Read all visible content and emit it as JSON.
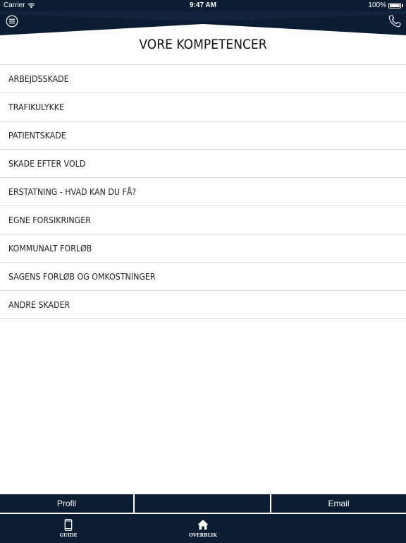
{
  "status_bar": {
    "carrier": "Carrier",
    "time": "9:47 AM",
    "battery": "100%"
  },
  "header": {
    "menu_icon": "menu-circle-icon",
    "phone_icon": "phone-icon",
    "accent_color": "#0c1c33"
  },
  "page": {
    "title": "VORE KOMPETENCER"
  },
  "list": {
    "items": [
      "ARBEJDSSKADE",
      "TRAFIKULYKKE",
      "PATIENTSKADE",
      "SKADE EFTER VOLD",
      "ERSTATNING - HVAD KAN DU FÅ?",
      "EGNE FORSIKRINGER",
      "KOMMUNALT FORLØB",
      "SAGENS FORLØB OG OMKOSTNINGER",
      "ANDRE SKADER"
    ]
  },
  "action_bar": {
    "profil": "Profil",
    "middle": "",
    "email": "Email"
  },
  "tabs": [
    {
      "label": "GUIDE",
      "icon": "phone-device-icon"
    },
    {
      "label": "OVERBLIK",
      "icon": "home-icon"
    }
  ]
}
